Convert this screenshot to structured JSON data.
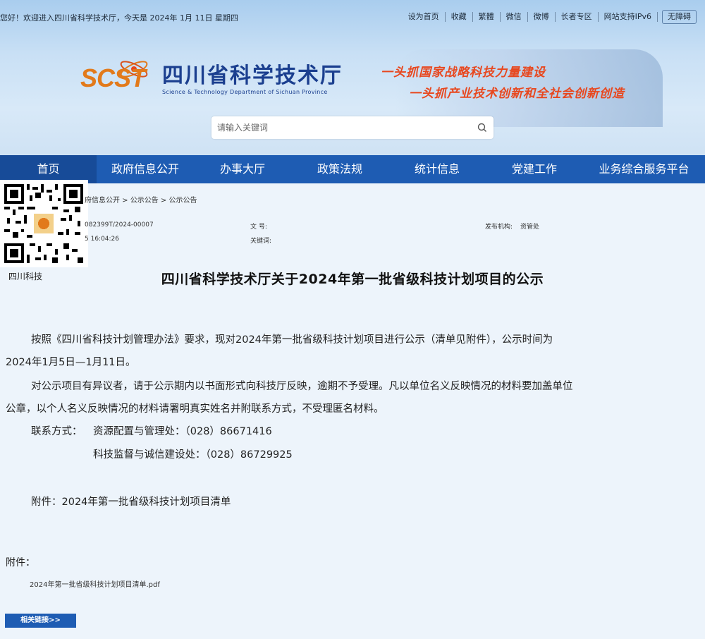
{
  "topbar": {
    "greeting": "您好！欢迎进入四川省科学技术厅，今天是   2024年 1月 11日   星期四",
    "links": [
      "设为首页",
      "收藏",
      "繁體",
      "微信",
      "微博",
      "长者专区",
      "网站支持IPv6"
    ],
    "accessibility": "无障碍"
  },
  "header": {
    "logo_mark": "SCST",
    "site_name": "四川省科学技术厅",
    "site_name_en": "Science & Technology Department of Sichuan Province",
    "slogan_1": "一头抓国家战略科技力量建设",
    "slogan_2": "一头抓产业技术创新和全社会创新创造"
  },
  "search": {
    "placeholder": "请输入关键词",
    "icon": "search-icon"
  },
  "nav": {
    "items": [
      "首页",
      "政府信息公开",
      "办事大厅",
      "政策法规",
      "统计信息",
      "党建工作",
      "业务综合服务平台"
    ]
  },
  "qr": {
    "caption": "四川科技"
  },
  "breadcrumb": "府信息公开 > 公示公告 > 公示公告",
  "meta": {
    "index_no": "082399T/2024-00007",
    "date": "5 16:04:26",
    "doc_no_label": "文 号:",
    "keywords_label": "关键词:",
    "publisher_label": "发布机构:",
    "publisher": "资管处"
  },
  "article": {
    "title": "四川省科学技术厅关于2024年第一批省级科技计划项目的公示",
    "p1_line1": "按照《四川省科技计划管理办法》要求，现对2024年第一批省级科技计划项目进行公示（清单见附件），公示时间为",
    "p1_line2": "2024年1月5日—1月11日。",
    "p2_line1": "对公示项目有异议者，请于公示期内以书面形式向科技厅反映，逾期不予受理。凡以单位名义反映情况的材料要加盖单位",
    "p2_line2": "公章，以个人名义反映情况的材料请署明真实姓名并附联系方式，不受理匿名材料。",
    "contact_label": "联系方式：",
    "contact1": "资源配置与管理处：（028）86671416",
    "contact2": "科技监督与诚信建设处：（028）86729925",
    "attachment_line": "附件：2024年第一批省级科技计划项目清单"
  },
  "attachments": {
    "label": "附件：",
    "file": "2024年第一批省级科技计划项目清单.pdf"
  },
  "related_button": "相关链接>>",
  "colors": {
    "nav_bg": "#1e5cb3",
    "logo_blue": "#1b3f8f",
    "slogan_red": "#e8471e",
    "logo_orange": "#e27a1b"
  }
}
